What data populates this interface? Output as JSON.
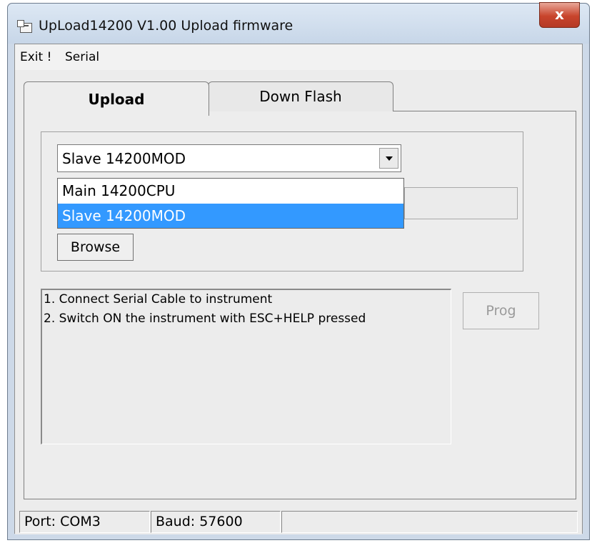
{
  "window": {
    "title": "UpLoad14200  V1.00  Upload firmware",
    "close_label": "x"
  },
  "menu": {
    "items": [
      "Exit !",
      "Serial"
    ]
  },
  "tabs": [
    {
      "label": "Upload",
      "active": true
    },
    {
      "label": "Down Flash",
      "active": false
    }
  ],
  "upload": {
    "target_select": {
      "value": "Slave 14200MOD",
      "options": [
        "Main  14200CPU",
        "Slave 14200MOD"
      ],
      "highlighted_option": "Slave 14200MOD"
    },
    "file_path": "",
    "browse_label": "Browse",
    "instructions": [
      "1. Connect Serial Cable to instrument",
      "2. Switch ON the instrument with ESC+HELP pressed"
    ],
    "prog_label": "Prog",
    "prog_enabled": false
  },
  "status": {
    "port": "Port: COM3",
    "baud": "Baud: 57600",
    "extra": ""
  },
  "colors": {
    "selection": "#3399ff",
    "close_button": "#c8442c",
    "titlebar": "#cdd9e8"
  }
}
